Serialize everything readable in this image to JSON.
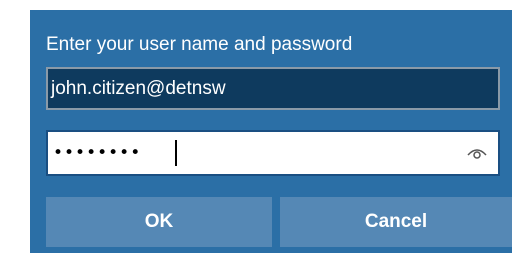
{
  "dialog": {
    "prompt": "Enter your user name and password",
    "username_value": "john.citizen@detnsw",
    "password_masked": "••••••••",
    "ok_label": "OK",
    "cancel_label": "Cancel",
    "reveal_icon": "eye-icon"
  },
  "colors": {
    "dialog_background": "#2b6fa6",
    "username_background": "#0e3a5e",
    "button_background": "#5588b5",
    "text": "#ffffff"
  }
}
